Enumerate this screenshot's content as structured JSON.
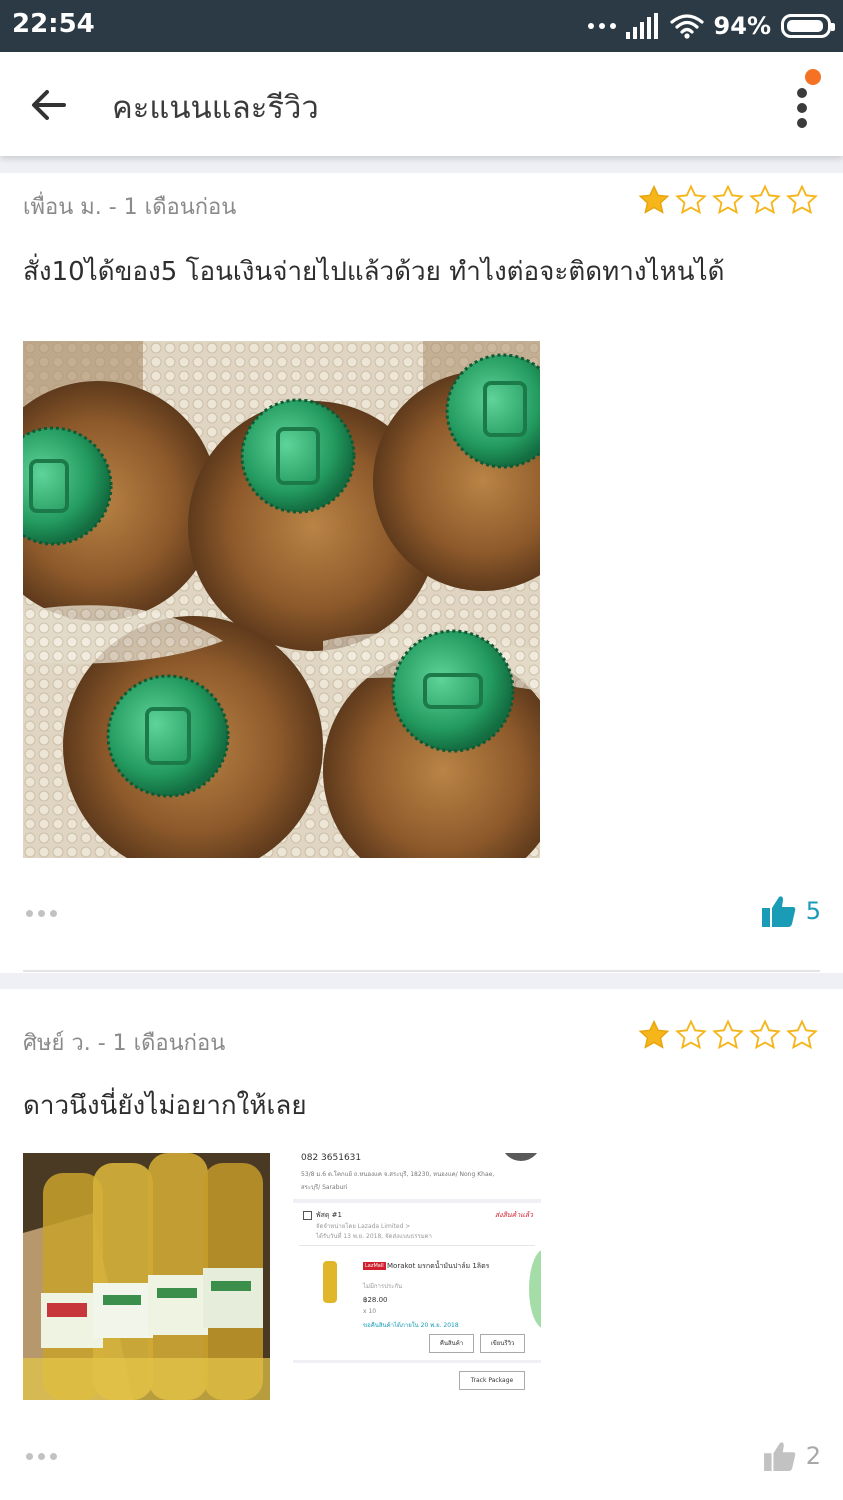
{
  "status_bar": {
    "time": "22:54",
    "battery_percent": "94%",
    "icons": [
      "more-dots-icon",
      "signal-icon",
      "wifi-icon",
      "battery-icon"
    ]
  },
  "header": {
    "title": "คะแนนและรีวิว",
    "back_icon": "arrow-left-icon",
    "menu_icon": "more-vertical-icon",
    "notification_color": "#f57224"
  },
  "colors": {
    "status_bar": "#2b3a44",
    "star_filled": "#f5b51b",
    "like_active": "#1a9cb7",
    "like_inactive": "#c2c2c2",
    "page_gap": "#eff0f5"
  },
  "reviews": [
    {
      "reviewer": "เพื่อน ม. - 1  เดือนก่อน",
      "rating": 1,
      "max_rating": 5,
      "text": "สั่ง10ได้ของ5 โอนเงินจ่ายไปแล้วด้วย ทำไงต่อจะติดทางไหนได้",
      "photos": [
        "cooking-oil-bottles-photo"
      ],
      "likes": "5",
      "liked": true
    },
    {
      "reviewer": "ศิษย์ ว. - 1  เดือนก่อน",
      "rating": 1,
      "max_rating": 5,
      "text": "ดาวนึงนี่ยังไม่อยากให้เลย",
      "photos": [
        "oil-bottles-box-photo",
        "order-screenshot-photo"
      ],
      "likes": "2",
      "liked": false,
      "order_screenshot": {
        "phone": "082 3651631",
        "address_line1": "53/8 ม.6 ต.โคกแย้ ถ.หนองแค จ.สระบุรี, 18230, หนองแค/ Nong Khae,",
        "address_line2": "สระบุรี/ Saraburi",
        "package_label": "พัสดุ #1",
        "package_status": "ส่งสินค้าแล้ว",
        "seller_line": "จัดจำหน่ายโดย Lazada Limited >",
        "delivery_line": "ได้รับวันที่ 13 พ.ย. 2018, จัดส่งแบบธรรมดา",
        "mall_badge": "LazMall",
        "product_name": "Morakot มรกตน้ำมันปาล์ม 1ลิตร",
        "warranty": "ไม่มีการประกัน",
        "price": "฿28.00",
        "quantity": "x 10",
        "return_note": "ขอคืนสินค้าได้ภายใน 20 พ.ย. 2018",
        "return_button": "คืนสินค้า",
        "review_button": "เขียนรีวิว",
        "track_button": "Track Package"
      }
    }
  ]
}
